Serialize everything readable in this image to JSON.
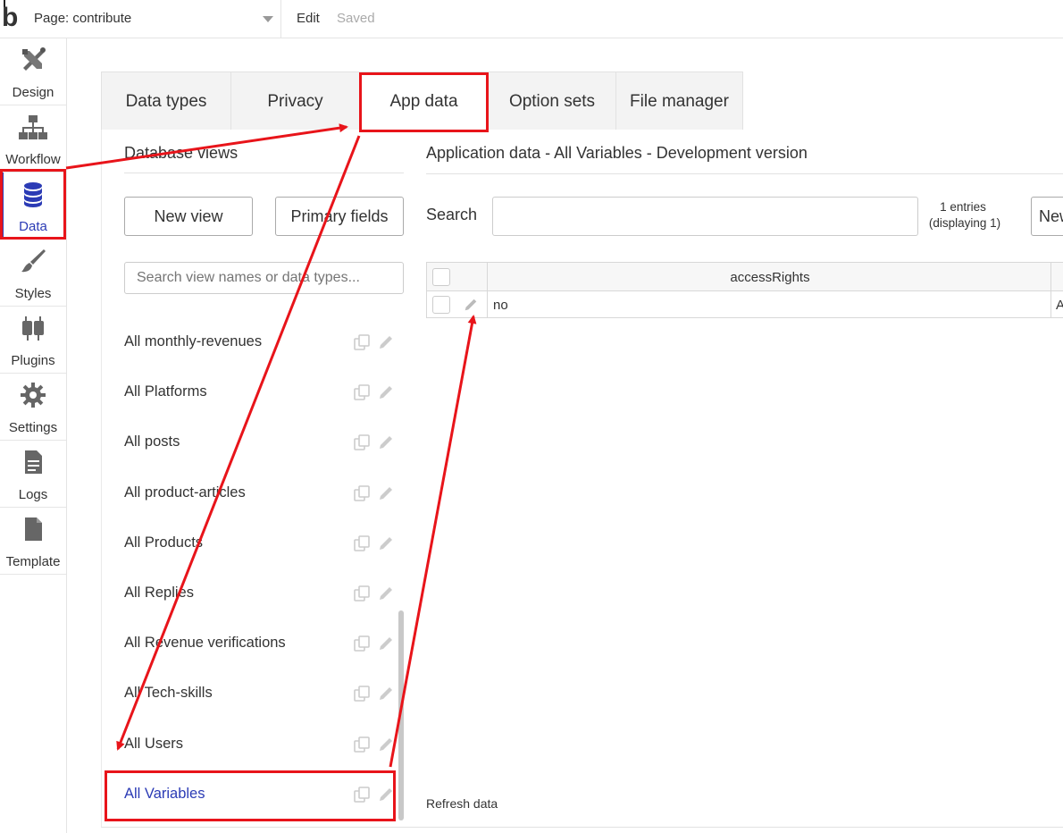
{
  "topbar": {
    "logo": "b",
    "page_label": "Page: contribute",
    "edit_label": "Edit",
    "saved_label": "Saved"
  },
  "nav": {
    "items": [
      {
        "label": "Design",
        "icon": "design-icon"
      },
      {
        "label": "Workflow",
        "icon": "workflow-icon"
      },
      {
        "label": "Data",
        "icon": "data-icon",
        "active": true
      },
      {
        "label": "Styles",
        "icon": "brush-icon"
      },
      {
        "label": "Plugins",
        "icon": "plug-icon"
      },
      {
        "label": "Settings",
        "icon": "gear-icon"
      },
      {
        "label": "Logs",
        "icon": "document-icon"
      },
      {
        "label": "Template",
        "icon": "template-icon"
      }
    ]
  },
  "tabs": [
    {
      "label": "Data types"
    },
    {
      "label": "Privacy"
    },
    {
      "label": "App data",
      "active": true
    },
    {
      "label": "Option sets"
    },
    {
      "label": "File manager"
    }
  ],
  "database_views": {
    "title": "Database views",
    "new_view_label": "New view",
    "primary_fields_label": "Primary fields",
    "search_placeholder": "Search view names or data types...",
    "items": [
      {
        "label": "All monthly-revenues"
      },
      {
        "label": "All Platforms"
      },
      {
        "label": "All posts"
      },
      {
        "label": "All product-articles"
      },
      {
        "label": "All Products"
      },
      {
        "label": "All Replies"
      },
      {
        "label": "All Revenue verifications"
      },
      {
        "label": "All Tech-skills"
      },
      {
        "label": "All Users"
      },
      {
        "label": "All Variables",
        "active": true
      }
    ]
  },
  "app_data": {
    "title": "Application data - All Variables - Development version",
    "search_label": "Search",
    "entries_count": "1 entries",
    "entries_displaying": "(displaying 1)",
    "new_button_label": "New",
    "columns": [
      "accessRights"
    ],
    "rows": [
      {
        "accessRights": "no",
        "next_col_fragment": "A"
      }
    ],
    "refresh_label": "Refresh data"
  },
  "colors": {
    "accent": "#2b3bb5",
    "annotation": "#e8141a"
  }
}
